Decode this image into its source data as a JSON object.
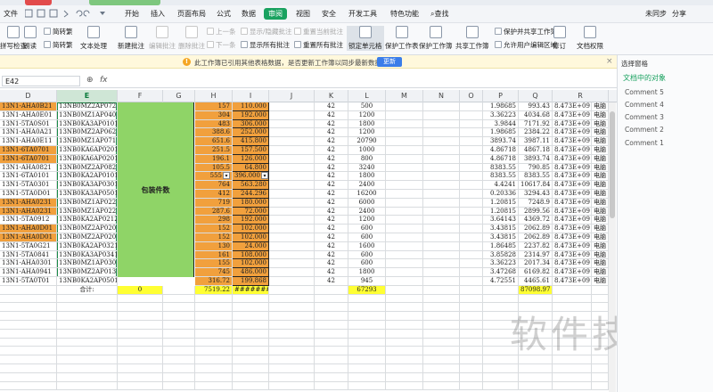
{
  "menubar": {
    "file": "文件",
    "items": [
      "开始",
      "插入",
      "页面布局",
      "公式",
      "数据",
      "审阅",
      "视图",
      "安全",
      "开发工具",
      "特色功能"
    ],
    "active_index": 5,
    "search": "查找",
    "sync": "未同步",
    "collab": "协作",
    "share": "分享"
  },
  "ribbon": {
    "big": [
      "拼写检查",
      "朗读",
      "文档校对",
      "翻译",
      "文本处理",
      "新建批注",
      "编辑批注",
      "删除批注",
      "锁定单元格",
      "保护工作表",
      "保护工作簿",
      "共享工作簿",
      "修订",
      "文档权限"
    ],
    "small": {
      "prev": "上一条",
      "next": "下一条",
      "show_hide": "显示/隐藏批注",
      "show_all": "显示所有批注",
      "reset_current": "重置当前批注",
      "reset_all": "重置所有批注",
      "protect_share": "保护并共享工作簿",
      "allow_edit": "允许用户编辑区域",
      "simp_trad_1": "简转繁",
      "simp_trad_2": "简转繁"
    }
  },
  "notice": {
    "message": "此工作簿已引用其他表格数据，是否更新工作簿以同步最新数据？",
    "update_button": "更新",
    "close": "×"
  },
  "formula": {
    "cell_ref": "E42",
    "fx": "fx",
    "content": ""
  },
  "right_pane": {
    "title": "选择窗格",
    "subtitle": "文档中的对象",
    "comments": [
      "Comment 5",
      "Comment 4",
      "Comment 3",
      "Comment 2",
      "Comment 1"
    ]
  },
  "watermark": "软件技巧",
  "columns": [
    "D",
    "E",
    "F",
    "G",
    "H",
    "I",
    "J",
    "K",
    "L",
    "M",
    "N",
    "O",
    "P",
    "Q",
    "R"
  ],
  "merged_label": "包装件数",
  "rows": [
    {
      "d": "13N1-AHA0B21",
      "e": "13NB0MZ2AP0721",
      "h": "157",
      "i": "110.000",
      "k": "42",
      "l": "500",
      "p": "1.98685",
      "q": "993.43",
      "r": "8.473E+09",
      "s": "电脑",
      "ho": true
    },
    {
      "d": "13N1-AHA0E01",
      "e": "13NB0MZ1AP0401",
      "h": "304",
      "i": "192.000",
      "k": "42",
      "l": "1200",
      "p": "3.36223",
      "q": "4034.68",
      "r": "8.473E+09",
      "s": "电脑"
    },
    {
      "d": "13N1-5TA0S01",
      "e": "13NB0KA3AP0101",
      "h": "483",
      "i": "306.000",
      "k": "42",
      "l": "1800",
      "p": "3.9844",
      "q": "7171.92",
      "r": "8.473E+09",
      "s": "电脑"
    },
    {
      "d": "13N1-AHA0A21",
      "e": "13NB0MZ2AP0621",
      "h": "388.6",
      "i": "252.000",
      "k": "42",
      "l": "1200",
      "p": "1.98685",
      "q": "2384.22",
      "r": "8.473E+09",
      "s": "电脑"
    },
    {
      "d": "13N1-AHA0E11",
      "e": "13NB0MZ1AP0711",
      "h": "651.6",
      "i": "415.800",
      "k": "42",
      "l": "20790",
      "p": "3893.74",
      "q": "3987.11",
      "r": "8.473E+09",
      "s": "电脑"
    },
    {
      "d": "13N1-6TA0701",
      "e": "13NB0KA6AP0201",
      "h": "251.5",
      "i": "157.500",
      "k": "42",
      "l": "1000",
      "p": "4.86718",
      "q": "4867.18",
      "r": "8.473E+09",
      "s": "电脑",
      "do": true
    },
    {
      "d": "13N1-6TA0701",
      "e": "13NB0KA6AP0201",
      "h": "196.1",
      "i": "126.000",
      "k": "42",
      "l": "800",
      "p": "4.86718",
      "q": "3893.74",
      "r": "8.473E+09",
      "s": "电脑",
      "do": true
    },
    {
      "d": "13N1-AHA0821",
      "e": "13NB0MZ2AP0821",
      "h": "105.5",
      "i": "64.800",
      "k": "42",
      "l": "3240",
      "p": "8383.55",
      "q": "790.85",
      "r": "8.473E+09",
      "s": "电脑"
    },
    {
      "d": "13N1-6TA0101",
      "e": "13NB0KA2AP0101",
      "h": "555",
      "i": "396.000",
      "k": "42",
      "l": "1800",
      "p": "8383.55",
      "q": "8383.55",
      "r": "8.473E+09",
      "s": "电脑",
      "dd": true
    },
    {
      "d": "13N1-5TA0301",
      "e": "13NB0KA3AP0301",
      "h": "764",
      "i": "563.280",
      "k": "42",
      "l": "2400",
      "p": "4.4241",
      "q": "10617.84",
      "r": "8.473E+09",
      "s": "电脑"
    },
    {
      "d": "13N1-5TA0D01",
      "e": "13NB0KA3AP0501",
      "h": "412",
      "i": "244.296",
      "k": "42",
      "l": "16200",
      "p": "0.20336",
      "q": "3294.43",
      "r": "8.473E+09",
      "s": "电脑"
    },
    {
      "d": "13N1-AHA0231",
      "e": "13NB0MZ1AP0221",
      "h": "719",
      "i": "180.000",
      "k": "42",
      "l": "6000",
      "p": "1.20815",
      "q": "7248.9",
      "r": "8.473E+09",
      "s": "电脑",
      "do": true
    },
    {
      "d": "13N1-AHA0231",
      "e": "13NB0MZ1AP0221",
      "h": "287.6",
      "i": "72.000",
      "k": "42",
      "l": "2400",
      "p": "1.20815",
      "q": "2899.56",
      "r": "8.473E+09",
      "s": "电脑",
      "do": true
    },
    {
      "d": "13N1-5TA0912",
      "e": "13NB0KA2AP0212",
      "h": "298",
      "i": "192.000",
      "k": "42",
      "l": "1200",
      "p": "3.64143",
      "q": "4369.72",
      "r": "8.473E+09",
      "s": "电脑"
    },
    {
      "d": "13N1-AHA0D01",
      "e": "13NB0MZ2AP0201",
      "h": "152",
      "i": "102.000",
      "k": "42",
      "l": "600",
      "p": "3.43815",
      "q": "2062.89",
      "r": "8.473E+09",
      "s": "电脑",
      "do": true
    },
    {
      "d": "13N1-AHA0D01",
      "e": "13NB0MZ2AP0201",
      "h": "152",
      "i": "102.000",
      "k": "42",
      "l": "600",
      "p": "3.43815",
      "q": "2062.89",
      "r": "8.473E+09",
      "s": "电脑",
      "do": true
    },
    {
      "d": "13N1-5TA0G21",
      "e": "13NB0KA2AP0321",
      "h": "130",
      "i": "24.000",
      "k": "42",
      "l": "1600",
      "p": "1.86485",
      "q": "2237.82",
      "r": "8.473E+09",
      "s": "电脑"
    },
    {
      "d": "13N1-5TA0841",
      "e": "13NB0KA3AP0341",
      "h": "161",
      "i": "108.000",
      "k": "42",
      "l": "600",
      "p": "3.85828",
      "q": "2314.97",
      "r": "8.473E+09",
      "s": "电脑"
    },
    {
      "d": "13N1-AHA0301",
      "e": "13NB0MZ1AP0301",
      "h": "155",
      "i": "102.000",
      "k": "42",
      "l": "600",
      "p": "3.36223",
      "q": "2017.34",
      "r": "8.473E+09",
      "s": "电脑"
    },
    {
      "d": "13N1-AHA0941",
      "e": "13NB0MZ2AP0131",
      "h": "745",
      "i": "486.000",
      "k": "42",
      "l": "1800",
      "p": "3.47268",
      "q": "6169.82",
      "r": "8.473E+09",
      "s": "电脑"
    },
    {
      "d": "13N1-5TA0T01",
      "e": "13NB0KA2AP0501",
      "h": "316.72",
      "i": "199.868",
      "k": "42",
      "l": "945",
      "p": "4.72551",
      "q": "4465.61",
      "r": "8.473E+09",
      "s": "电脑"
    }
  ],
  "total_row": {
    "label": "合计:",
    "f": "0",
    "h": "7519.22",
    "i": "########",
    "l": "67293",
    "q": "87098.97"
  }
}
